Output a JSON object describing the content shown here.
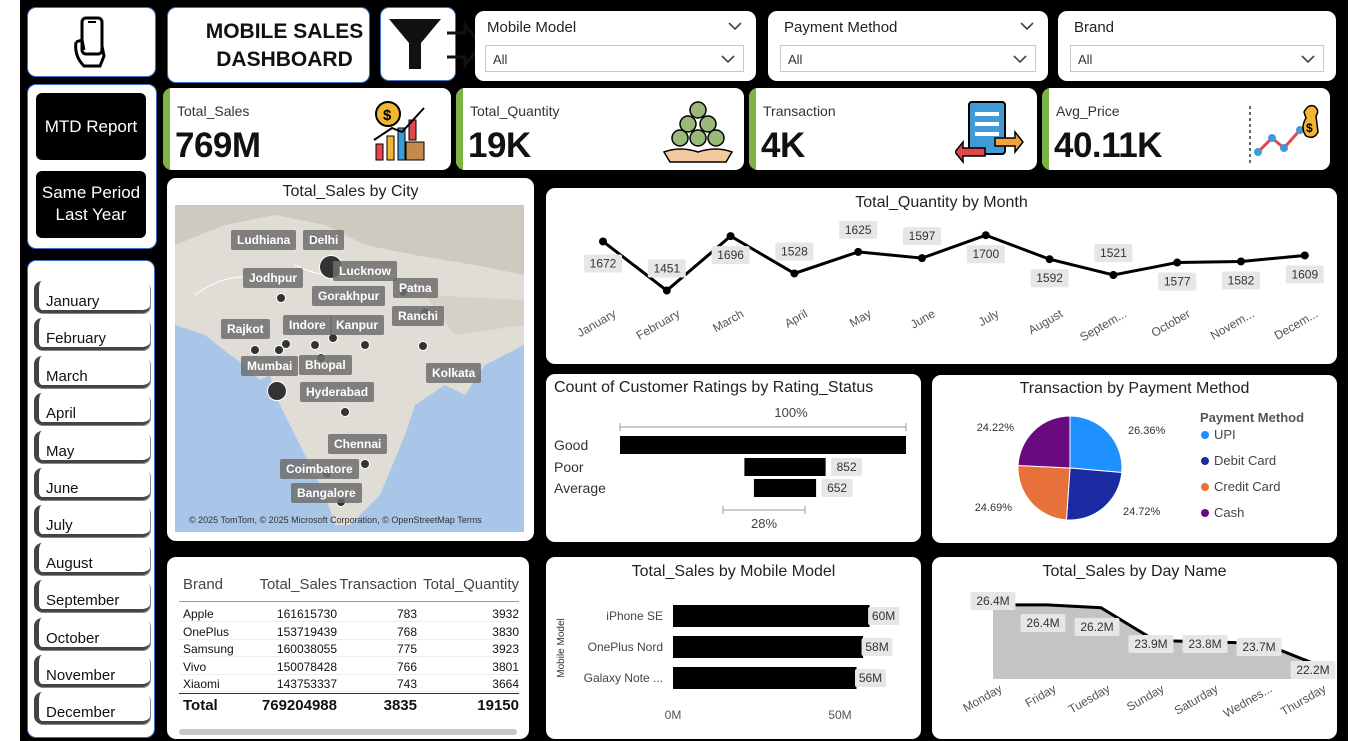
{
  "header": {
    "title_line1": "MOBILE SALES",
    "title_line2": "DASHBOARD"
  },
  "icons": {
    "phone": "hand-phone-icon",
    "filter": "filter-arrow-icon"
  },
  "slicers": [
    {
      "label": "Mobile Model",
      "value": "All"
    },
    {
      "label": "Payment Method",
      "value": "All"
    },
    {
      "label": "Brand",
      "value": "All"
    }
  ],
  "nav": {
    "mtd": "MTD Report",
    "spl_line1": "Same Period",
    "spl_line2": "Last Year"
  },
  "months": [
    "January",
    "February",
    "March",
    "April",
    "May",
    "June",
    "July",
    "August",
    "September",
    "October",
    "November",
    "December"
  ],
  "kpis": [
    {
      "label": "Total_Sales",
      "value": "769M",
      "icon": "money-growth-icon"
    },
    {
      "label": "Total_Quantity",
      "value": "19K",
      "icon": "coin-stack-icon"
    },
    {
      "label": "Transaction",
      "value": "4K",
      "icon": "transaction-icon"
    },
    {
      "label": "Avg_Price",
      "value": "40.11K",
      "icon": "price-trend-icon"
    }
  ],
  "colors": {
    "accent": "#7cb342",
    "upi": "#1e90ff",
    "debit": "#1a2aa0",
    "credit": "#e8703a",
    "cash": "#6a0a80"
  },
  "map": {
    "title": "Total_Sales by City",
    "attribution": "© 2025 TomTom, © 2025 Microsoft Corporation, © OpenStreetMap  Terms",
    "cities": [
      "Ludhiana",
      "Delhi",
      "Jodhpur",
      "Lucknow",
      "Gorakhpur",
      "Patna",
      "Indore",
      "Kanpur",
      "Ranchi",
      "Rajkot",
      "Mumbai",
      "Bhopal",
      "Kolkata",
      "Hyderabad",
      "Chennai",
      "Coimbatore",
      "Bangalore"
    ]
  },
  "chart_data": [
    {
      "type": "line",
      "title": "Total_Quantity by Month",
      "categories": [
        "January",
        "February",
        "March",
        "April",
        "May",
        "June",
        "July",
        "August",
        "Septem...",
        "October",
        "Novem...",
        "Decem..."
      ],
      "values": [
        1672,
        1451,
        1696,
        1528,
        1625,
        1597,
        1700,
        1592,
        1521,
        1577,
        1582,
        1609
      ]
    },
    {
      "type": "bar",
      "title": "Count of Customer Ratings by Rating_Status",
      "categories": [
        "Good",
        "Poor",
        "Average"
      ],
      "values": [
        3000,
        852,
        652
      ],
      "value_labels": [
        "",
        "852",
        "652"
      ],
      "top_label": "100%",
      "bottom_label": "28%"
    },
    {
      "type": "pie",
      "title": "Transaction by Payment Method",
      "legend_title": "Payment Method",
      "categories": [
        "UPI",
        "Debit Card",
        "Credit Card",
        "Cash"
      ],
      "values": [
        26.36,
        24.72,
        24.69,
        24.22
      ],
      "value_labels": [
        "26.36%",
        "24.72%",
        "24.69%",
        "24.22%"
      ]
    },
    {
      "type": "bar",
      "title": "Total_Sales by Mobile Model",
      "ylabel": "Mobile Model",
      "categories": [
        "iPhone SE",
        "OnePlus Nord",
        "Galaxy Note ..."
      ],
      "values": [
        60,
        58,
        56
      ],
      "value_labels": [
        "60M",
        "58M",
        "56M"
      ],
      "xticks": [
        "0M",
        "50M"
      ],
      "xlim": [
        0,
        60
      ]
    },
    {
      "type": "area",
      "title": "Total_Sales by Day Name",
      "categories": [
        "Monday",
        "Friday",
        "Tuesday",
        "Sunday",
        "Saturday",
        "Wednes...",
        "Thursday"
      ],
      "values": [
        26.4,
        26.4,
        26.2,
        23.9,
        23.8,
        23.7,
        22.2
      ],
      "value_labels": [
        "26.4M",
        "26.4M",
        "26.2M",
        "23.9M",
        "23.8M",
        "23.7M",
        "22.2M"
      ]
    },
    {
      "type": "table",
      "columns": [
        "Brand",
        "Total_Sales",
        "Transaction",
        "Total_Quantity"
      ],
      "rows": [
        [
          "Apple",
          "161615730",
          "783",
          "3932"
        ],
        [
          "OnePlus",
          "153719439",
          "768",
          "3830"
        ],
        [
          "Samsung",
          "160038055",
          "775",
          "3923"
        ],
        [
          "Vivo",
          "150078428",
          "766",
          "3801"
        ],
        [
          "Xiaomi",
          "143753337",
          "743",
          "3664"
        ]
      ],
      "total": [
        "Total",
        "769204988",
        "3835",
        "19150"
      ]
    }
  ]
}
